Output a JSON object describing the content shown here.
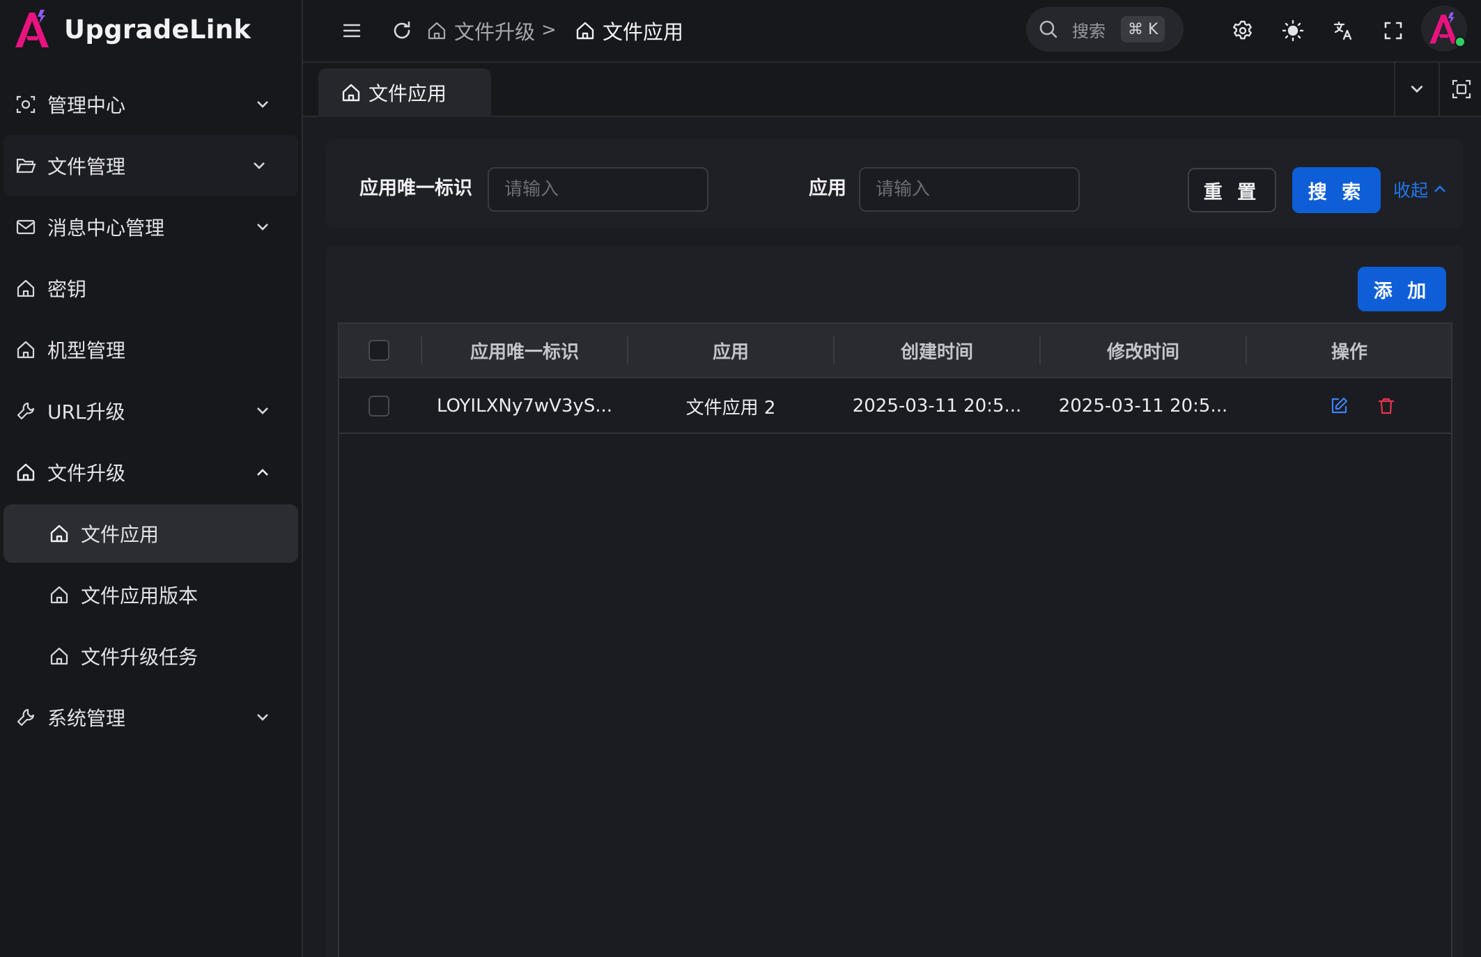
{
  "app": {
    "name": "UpgradeLink",
    "brand_color": "#e8137e",
    "accent_color": "#0e5ed8"
  },
  "sidebar": {
    "items": [
      {
        "label": "管理中心",
        "icon": "dashboard-icon",
        "expandable": true
      },
      {
        "label": "文件管理",
        "icon": "folder-icon",
        "expandable": true
      },
      {
        "label": "消息中心管理",
        "icon": "mail-icon",
        "expandable": true
      },
      {
        "label": "密钥",
        "icon": "home-icon",
        "expandable": false
      },
      {
        "label": "机型管理",
        "icon": "home-icon",
        "expandable": false
      },
      {
        "label": "URL升级",
        "icon": "wrench-icon",
        "expandable": true
      },
      {
        "label": "文件升级",
        "icon": "home-icon",
        "expandable": true,
        "expanded": true,
        "children": [
          {
            "label": "文件应用",
            "active": true
          },
          {
            "label": "文件应用版本"
          },
          {
            "label": "文件升级任务"
          }
        ]
      },
      {
        "label": "系统管理",
        "icon": "wrench-icon",
        "expandable": true
      }
    ]
  },
  "header": {
    "breadcrumb": [
      "文件升级",
      "文件应用"
    ],
    "breadcrumb_separator": ">",
    "search": {
      "label": "搜索",
      "shortcut": "⌘ K"
    }
  },
  "tabs": [
    {
      "label": "文件应用",
      "active": true
    }
  ],
  "filter": {
    "fields": [
      {
        "label": "应用唯一标识",
        "value": "",
        "placeholder": "请输入"
      },
      {
        "label": "应用",
        "value": "",
        "placeholder": "请输入"
      }
    ],
    "reset_label": "重 置",
    "search_label": "搜 索",
    "collapse_label": "收起"
  },
  "table": {
    "add_label": "添 加",
    "columns": [
      "应用唯一标识",
      "应用",
      "创建时间",
      "修改时间",
      "操作"
    ],
    "rows": [
      {
        "key": "LOYILXNy7wV3yS...",
        "app": "文件应用 2",
        "created": "2025-03-11 20:5...",
        "modified": "2025-03-11 20:5...",
        "actions": [
          "edit-icon",
          "delete-icon"
        ]
      }
    ]
  },
  "colors": {
    "edit": "#3b82f6",
    "delete": "#e8344e",
    "online": "#2fd15e"
  }
}
